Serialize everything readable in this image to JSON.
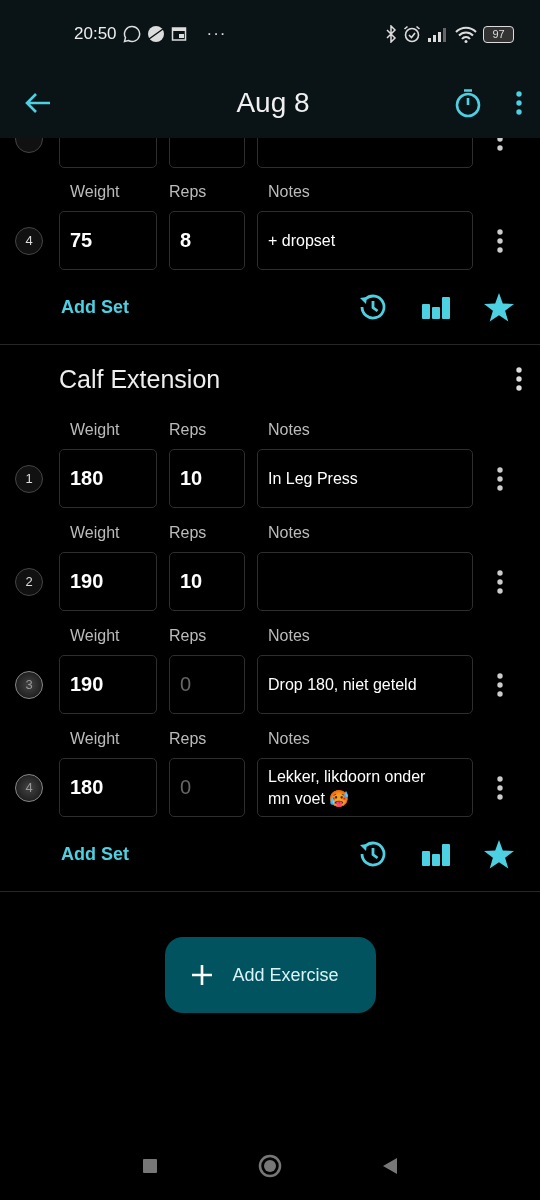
{
  "status_bar": {
    "time": "20:50",
    "more": "···",
    "battery": "97"
  },
  "toolbar": {
    "title": "Aug 8"
  },
  "exercises": [
    {
      "clipped_top": true,
      "add_set": "Add Set",
      "sets": [
        {
          "number": "4",
          "done": true,
          "weight": {
            "label": "Weight",
            "value": "75"
          },
          "reps": {
            "label": "Reps",
            "value": "8"
          },
          "notes": {
            "label": "Notes",
            "value": "+ dropset"
          }
        }
      ]
    },
    {
      "name": "Calf Extension",
      "clipped_top": false,
      "add_set": "Add Set",
      "sets": [
        {
          "number": "1",
          "done": true,
          "weight": {
            "label": "Weight",
            "value": "180"
          },
          "reps": {
            "label": "Reps",
            "value": "10"
          },
          "notes": {
            "label": "Notes",
            "value": "In Leg Press"
          }
        },
        {
          "number": "2",
          "done": true,
          "weight": {
            "label": "Weight",
            "value": "190"
          },
          "reps": {
            "label": "Reps",
            "value": "10"
          },
          "notes": {
            "label": "Notes"
          }
        },
        {
          "number": "3",
          "done": false,
          "weight": {
            "label": "Weight",
            "value": "190"
          },
          "reps": {
            "label": "Reps",
            "placeholder": "0"
          },
          "notes": {
            "label": "Notes",
            "value": "Drop 180, niet geteld"
          }
        },
        {
          "number": "4",
          "done": false,
          "weight": {
            "label": "Weight",
            "value": "180"
          },
          "reps": {
            "label": "Reps",
            "placeholder": "0"
          },
          "notes": {
            "label": "Notes",
            "value": "Lekker, likdoorn onder mn voet 🥵"
          }
        }
      ]
    }
  ],
  "add_exercise": "Add Exercise"
}
